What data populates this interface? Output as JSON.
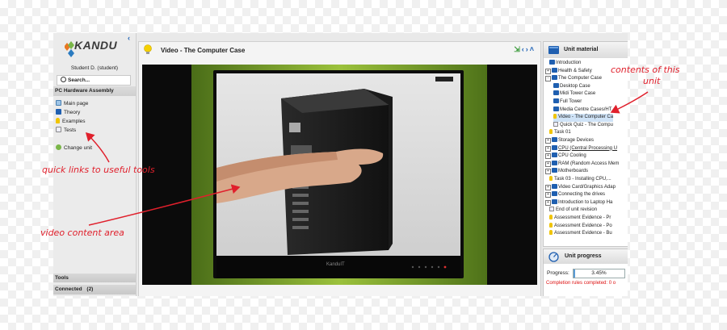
{
  "sidebar": {
    "logo_text": "KANDU",
    "student": "Student D. (student)",
    "search_label": "Search...",
    "course_title": "PC Hardware Assembly",
    "links": [
      {
        "label": "Main page",
        "icon": "home-icon"
      },
      {
        "label": "Theory",
        "icon": "book-icon"
      },
      {
        "label": "Examples",
        "icon": "lightbulb-icon"
      },
      {
        "label": "Tests",
        "icon": "pencil-icon"
      }
    ],
    "change_unit": "Change unit",
    "tools": "Tools",
    "connected": "Connected",
    "connected_count": "(2)"
  },
  "main": {
    "title": "Video - The Computer Case",
    "nav_icons": [
      "exit-icon",
      "prev-icon",
      "next-icon",
      "collapse-icon"
    ],
    "video_brand": "KanduIT"
  },
  "unit_material": {
    "title": "Unit material",
    "items": [
      {
        "label": "Introduction",
        "indent": 1,
        "icon": "book",
        "toggle": ""
      },
      {
        "label": "Health & Safety",
        "indent": 0,
        "icon": "book",
        "toggle": "+"
      },
      {
        "label": "The Computer Case",
        "indent": 0,
        "icon": "book",
        "toggle": "-"
      },
      {
        "label": "Desktop Case",
        "indent": 2,
        "icon": "book",
        "toggle": ""
      },
      {
        "label": "Midi Tower Case",
        "indent": 2,
        "icon": "book",
        "toggle": ""
      },
      {
        "label": "Full Tower",
        "indent": 2,
        "icon": "book",
        "toggle": ""
      },
      {
        "label": "Media Centre Cases/HT",
        "indent": 2,
        "icon": "book",
        "toggle": ""
      },
      {
        "label": "Video - The Computer Ca",
        "indent": 2,
        "icon": "bulb",
        "toggle": "",
        "selected": true
      },
      {
        "label": "Quick Quiz - The Compu",
        "indent": 2,
        "icon": "page",
        "toggle": ""
      },
      {
        "label": "Task 01",
        "indent": 1,
        "icon": "bulb",
        "toggle": ""
      },
      {
        "label": "Storage Devices",
        "indent": 0,
        "icon": "book",
        "toggle": "+"
      },
      {
        "label": "CPU (Central Processing U",
        "indent": 0,
        "icon": "book",
        "toggle": "+"
      },
      {
        "label": "CPU Cooling",
        "indent": 0,
        "icon": "book",
        "toggle": "+"
      },
      {
        "label": "RAM (Random Access Mem",
        "indent": 0,
        "icon": "book",
        "toggle": "+"
      },
      {
        "label": "Motherboards",
        "indent": 0,
        "icon": "book",
        "toggle": "+"
      },
      {
        "label": "Task 03 - Installing CPU,...",
        "indent": 1,
        "icon": "bulb",
        "toggle": ""
      },
      {
        "label": "Video Card/Graphics Adap",
        "indent": 0,
        "icon": "book",
        "toggle": "+"
      },
      {
        "label": "Connecting the drives",
        "indent": 0,
        "icon": "book",
        "toggle": "+"
      },
      {
        "label": "Introduction to Laptop Ha",
        "indent": 0,
        "icon": "book",
        "toggle": "+"
      },
      {
        "label": "End of unit revision",
        "indent": 1,
        "icon": "page",
        "toggle": ""
      },
      {
        "label": "Assessment Evidence - Pr",
        "indent": 1,
        "icon": "bulb",
        "toggle": ""
      },
      {
        "label": "Assessment Evidence - Po",
        "indent": 1,
        "icon": "bulb",
        "toggle": ""
      },
      {
        "label": "Assessment Evidence - Bu",
        "indent": 1,
        "icon": "bulb",
        "toggle": ""
      }
    ]
  },
  "unit_progress": {
    "title": "Unit progress",
    "progress_label": "Progress:",
    "progress_value": "3.45%",
    "progress_fraction": 0.0345,
    "completion_text": "Completion rules completed: 0 o"
  },
  "annotations": {
    "contents": "contents of this",
    "contents2": "unit",
    "quick_links": "quick links to useful tools",
    "video_area": "video content area"
  },
  "colors": {
    "annotation_red": "#e0202c",
    "accent_blue": "#1f5fb0",
    "video_green": "#7da531"
  }
}
